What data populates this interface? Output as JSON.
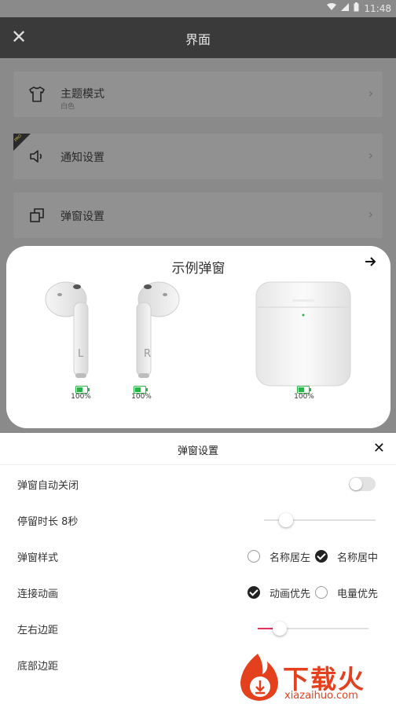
{
  "status_bar": {
    "time": "11:48"
  },
  "header": {
    "title": "界面",
    "close_icon": "close-icon"
  },
  "settings": {
    "items": [
      {
        "label": "主题模式",
        "sub": "白色",
        "icon": "tshirt-icon"
      },
      {
        "label": "通知设置",
        "badge": "PRO",
        "icon": "speaker-icon"
      },
      {
        "label": "弹窗设置",
        "icon": "windows-icon"
      }
    ]
  },
  "popup": {
    "title": "示例弹窗",
    "arrow_icon": "arrow-right-icon",
    "left": {
      "letter": "L",
      "battery": "100%"
    },
    "right": {
      "letter": "R",
      "battery": "100%"
    },
    "case": {
      "battery": "100%"
    }
  },
  "sheet": {
    "title": "弹窗设置",
    "auto_close": {
      "label": "弹窗自动关闭",
      "enabled": false
    },
    "stay_duration": {
      "label": "停留时长  8秒",
      "value": 0.17
    },
    "popup_style": {
      "label": "弹窗样式",
      "options": [
        "名称居左",
        "名称居中"
      ],
      "selected": 1
    },
    "connect_anim": {
      "label": "连接动画",
      "options": [
        "动画优先",
        "电量优先"
      ],
      "selected": 0
    },
    "lr_margin": {
      "label": "左右边距",
      "value": 0.18
    },
    "bottom_margin": {
      "label": "底部边距"
    }
  },
  "watermark": {
    "text": "下载火",
    "sub": "xiazaihuo.com"
  },
  "colors": {
    "accent": "#e2335a",
    "battery_green": "#2bb34a",
    "watermark": "#e4401e"
  }
}
